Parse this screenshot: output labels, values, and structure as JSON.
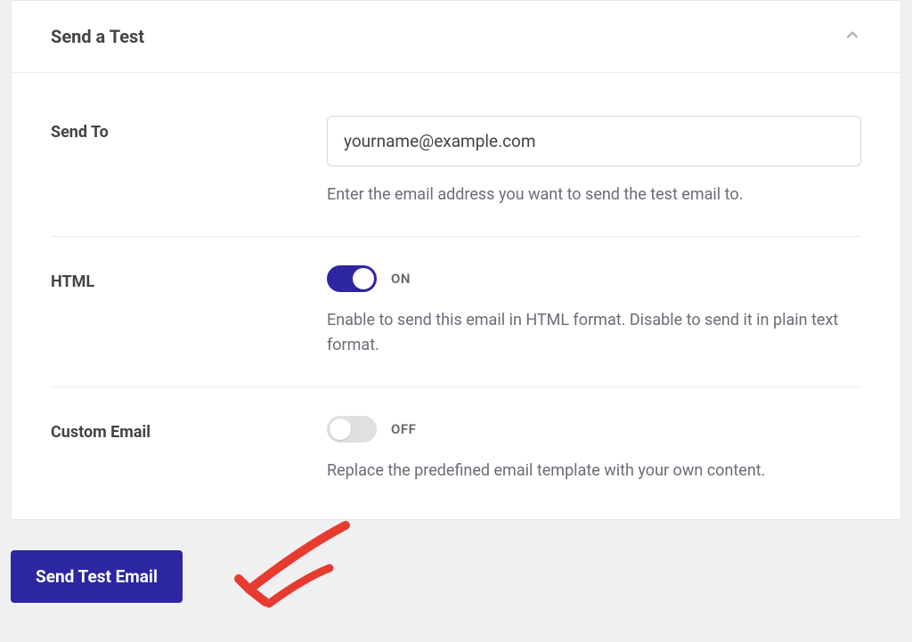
{
  "header": {
    "title": "Send a Test",
    "chevron_icon": "chevron-up"
  },
  "form": {
    "send_to": {
      "label": "Send To",
      "value": "yourname@example.com",
      "helper": "Enter the email address you want to send the test email to."
    },
    "html": {
      "label": "HTML",
      "state_label": "ON",
      "enabled": true,
      "helper": "Enable to send this email in HTML format. Disable to send it in plain text format."
    },
    "custom_email": {
      "label": "Custom Email",
      "state_label": "OFF",
      "enabled": false,
      "helper": "Replace the predefined email template with your own content."
    }
  },
  "actions": {
    "send_test_label": "Send Test Email"
  },
  "colors": {
    "accent": "#2d26a3",
    "text_muted": "#6c6c78",
    "annotation_red": "#e63b2e"
  }
}
